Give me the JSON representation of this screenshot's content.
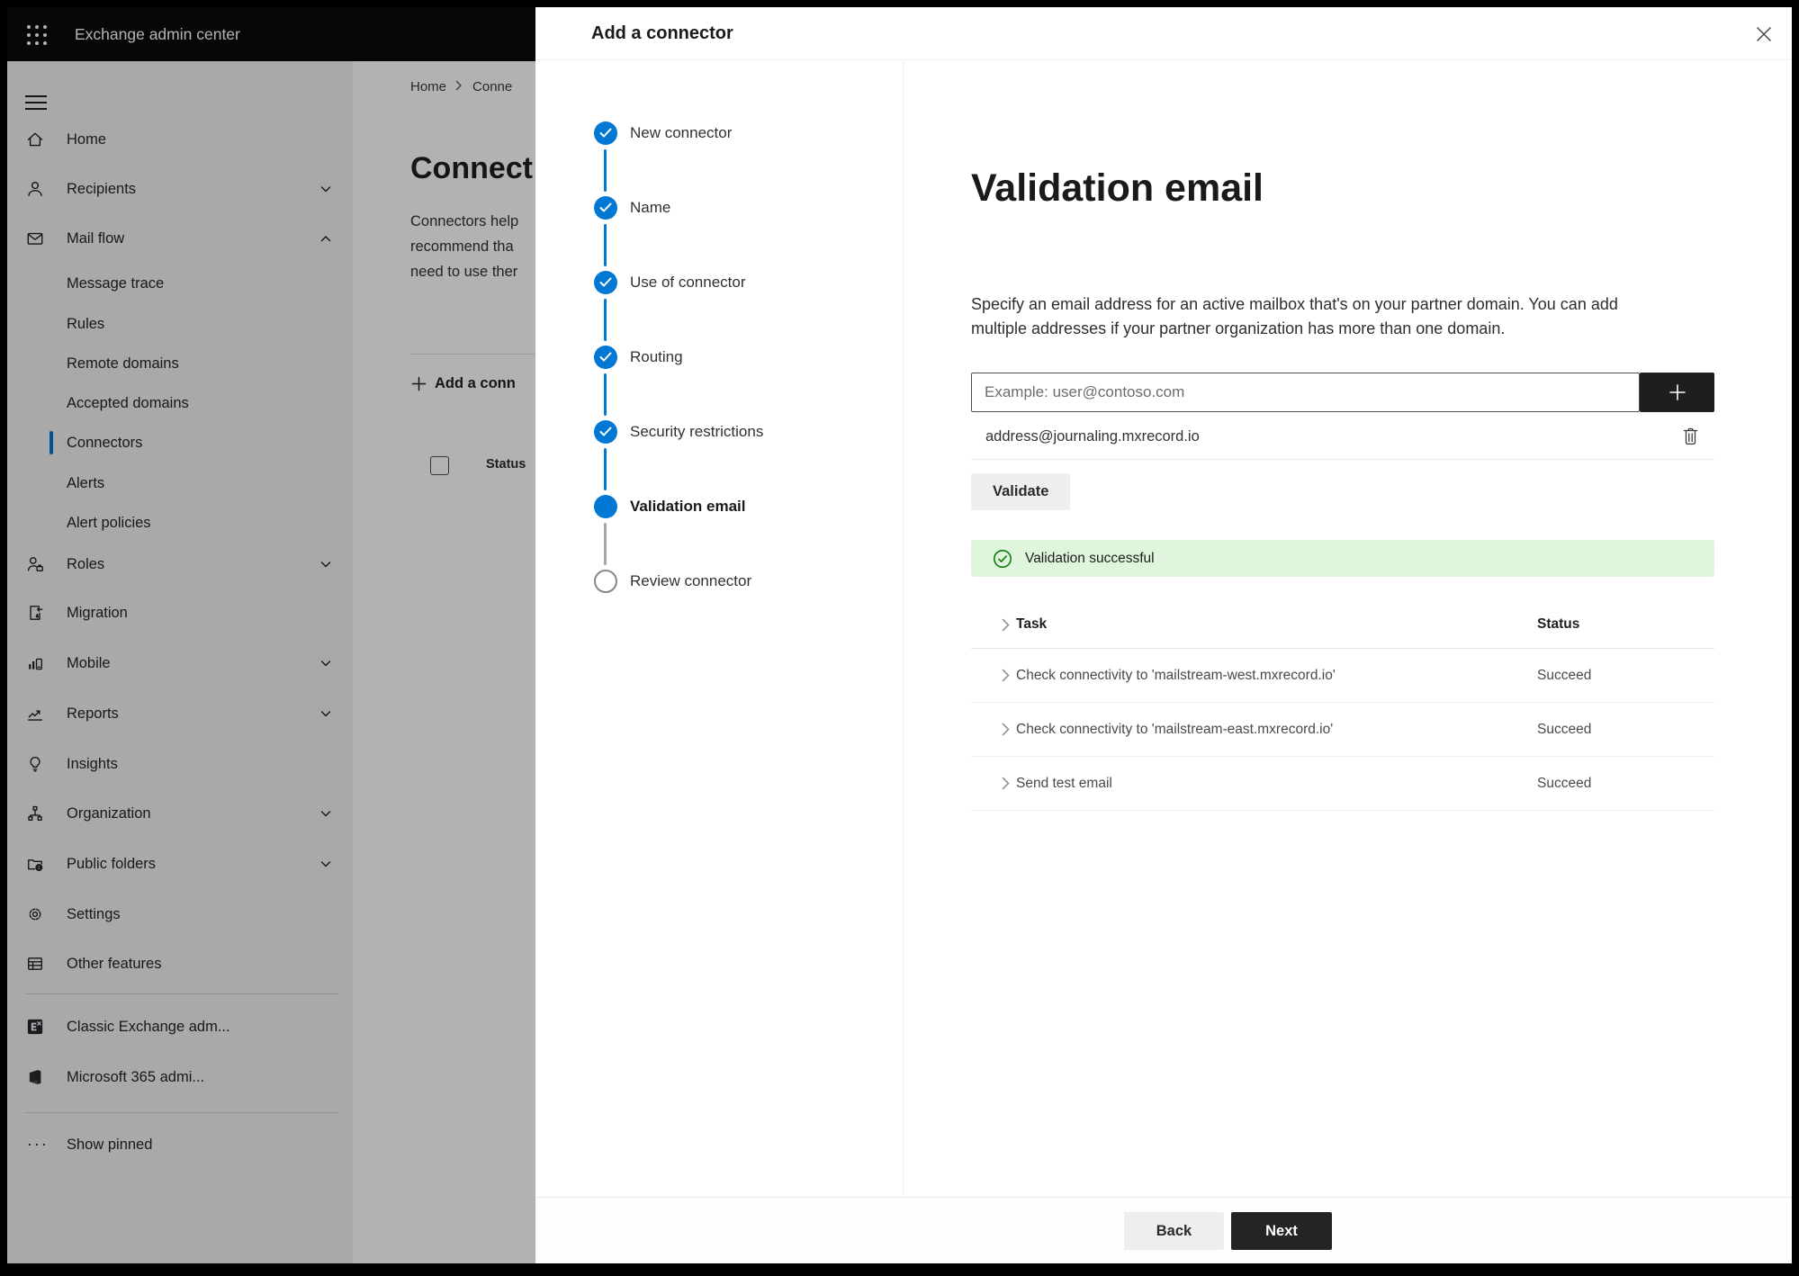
{
  "chrome": {
    "app_title": "Exchange admin center"
  },
  "sidebar": {
    "items": [
      {
        "label": "Home",
        "icon": "home-icon"
      },
      {
        "label": "Recipients",
        "icon": "person-icon",
        "chevron": "down"
      },
      {
        "label": "Mail flow",
        "icon": "mail-icon",
        "chevron": "up"
      },
      {
        "label": "Message trace"
      },
      {
        "label": "Rules"
      },
      {
        "label": "Remote domains"
      },
      {
        "label": "Accepted domains"
      },
      {
        "label": "Connectors",
        "selected": true
      },
      {
        "label": "Alerts"
      },
      {
        "label": "Alert policies"
      },
      {
        "label": "Roles",
        "icon": "roles-icon",
        "chevron": "down"
      },
      {
        "label": "Migration",
        "icon": "migration-icon"
      },
      {
        "label": "Mobile",
        "icon": "mobile-icon",
        "chevron": "down"
      },
      {
        "label": "Reports",
        "icon": "reports-icon",
        "chevron": "down"
      },
      {
        "label": "Insights",
        "icon": "lightbulb-icon"
      },
      {
        "label": "Organization",
        "icon": "org-chart-icon",
        "chevron": "down"
      },
      {
        "label": "Public folders",
        "icon": "folder-globe-icon",
        "chevron": "down"
      },
      {
        "label": "Settings",
        "icon": "gear-icon"
      },
      {
        "label": "Other features",
        "icon": "table-grid-icon"
      }
    ],
    "footer_items": [
      {
        "label": "Classic Exchange adm...",
        "icon": "exchange-logo-icon"
      },
      {
        "label": "Microsoft 365 admi...",
        "icon": "m365-logo-icon"
      }
    ],
    "show_pinned": "Show pinned"
  },
  "page": {
    "breadcrumb_home": "Home",
    "breadcrumb_current": "Conne",
    "title": "Connect",
    "desc_lines": [
      "Connectors help",
      "recommend tha",
      "need to use ther"
    ],
    "add_connector": "Add a conn",
    "status_header": "Status"
  },
  "wizard": {
    "title": "Add a connector",
    "steps": [
      {
        "label": "New connector",
        "state": "done"
      },
      {
        "label": "Name",
        "state": "done"
      },
      {
        "label": "Use of connector",
        "state": "done"
      },
      {
        "label": "Routing",
        "state": "done"
      },
      {
        "label": "Security restrictions",
        "state": "done"
      },
      {
        "label": "Validation email",
        "state": "current"
      },
      {
        "label": "Review connector",
        "state": "todo"
      }
    ]
  },
  "panel": {
    "title": "Validation email",
    "description": "Specify an email address for an active mailbox that's on your partner domain. You can add multiple addresses if your partner organization has more than one domain.",
    "input_placeholder": "Example: user@contoso.com",
    "address": "address@journaling.mxrecord.io",
    "validate_button": "Validate",
    "banner": "Validation successful",
    "table": {
      "task_header": "Task",
      "status_header": "Status",
      "rows": [
        {
          "task": "Check connectivity to 'mailstream-west.mxrecord.io'",
          "status": "Succeed"
        },
        {
          "task": "Check connectivity to 'mailstream-east.mxrecord.io'",
          "status": "Succeed"
        },
        {
          "task": "Send test email",
          "status": "Succeed"
        }
      ]
    },
    "back_button": "Back",
    "next_button": "Next"
  },
  "colors": {
    "accent": "#0078d4",
    "success_bg": "#dff6dd",
    "success_green": "#107c10",
    "next_button_bg": "#252423"
  }
}
